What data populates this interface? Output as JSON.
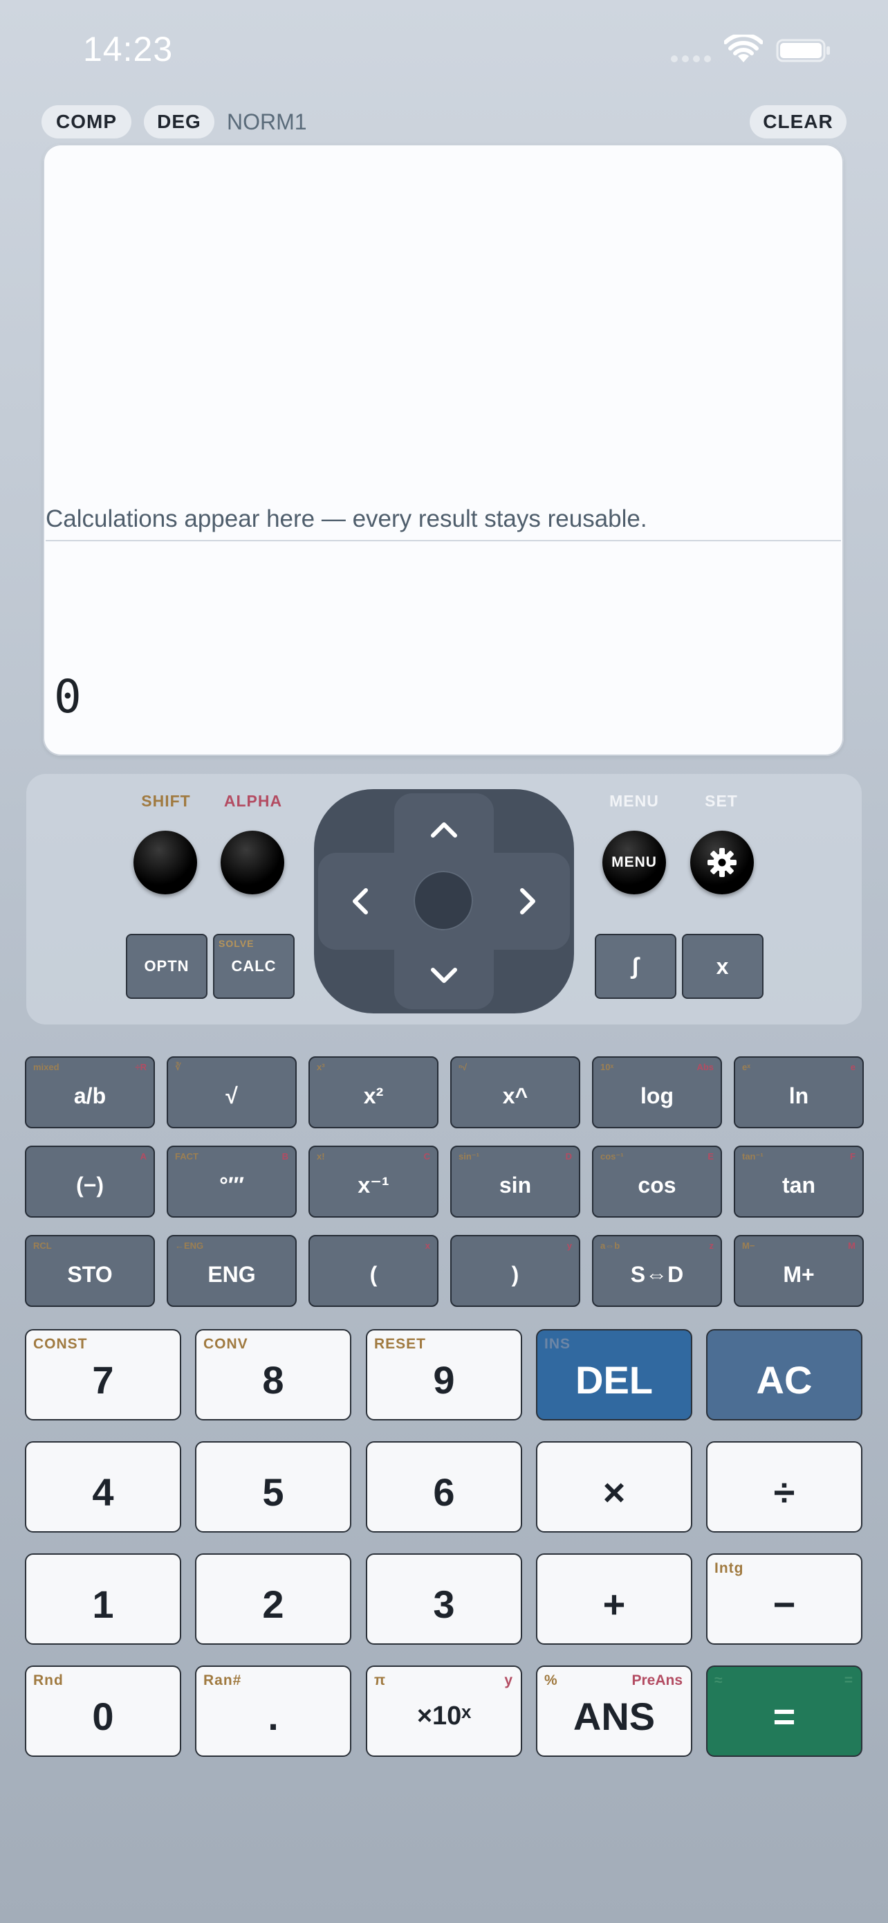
{
  "status_bar": {
    "time": "14:23"
  },
  "mode_bar": {
    "comp": "COMP",
    "deg": "DEG",
    "norm": "NORM1",
    "clear": "CLEAR"
  },
  "display": {
    "hint": "Calculations appear here — every result stays reusable.",
    "result": "0"
  },
  "controls": {
    "shift_label": "SHIFT",
    "alpha_label": "ALPHA",
    "menu_label": "MENU",
    "menu_button": "MENU",
    "set_label": "SET",
    "optn": "OPTN",
    "calc": "CALC",
    "calc_shift": "SOLVE",
    "integral": "∫",
    "x_key": "x"
  },
  "function_keys": [
    {
      "name": "fraction-key",
      "label": "a/b",
      "shift": "mixed",
      "alpha": "÷R"
    },
    {
      "name": "sqrt-key",
      "label": "√",
      "shift": "∛",
      "alpha": ""
    },
    {
      "name": "square-key",
      "label": "x²",
      "shift": "x³",
      "alpha": ""
    },
    {
      "name": "power-key",
      "label": "x^",
      "shift": "ⁿ√",
      "alpha": ""
    },
    {
      "name": "log-key",
      "label": "log",
      "shift": "10ˣ",
      "alpha": "Abs"
    },
    {
      "name": "ln-key",
      "label": "ln",
      "shift": "eˣ",
      "alpha": "e"
    },
    {
      "name": "negative-key",
      "label": "(−)",
      "shift": "",
      "alpha": "A"
    },
    {
      "name": "dms-key",
      "label": "°′″",
      "shift": "FACT",
      "alpha": "B"
    },
    {
      "name": "reciprocal-key",
      "label": "x⁻¹",
      "shift": "x!",
      "alpha": "C"
    },
    {
      "name": "sin-key",
      "label": "sin",
      "shift": "sin⁻¹",
      "alpha": "D"
    },
    {
      "name": "cos-key",
      "label": "cos",
      "shift": "cos⁻¹",
      "alpha": "E"
    },
    {
      "name": "tan-key",
      "label": "tan",
      "shift": "tan⁻¹",
      "alpha": "F"
    },
    {
      "name": "sto-key",
      "label": "STO",
      "shift": "RCL",
      "alpha": ""
    },
    {
      "name": "eng-key",
      "label": "ENG",
      "shift": "←ENG",
      "alpha": ""
    },
    {
      "name": "open-paren-key",
      "label": "(",
      "shift": "",
      "alpha": "x"
    },
    {
      "name": "close-paren-key",
      "label": ")",
      "shift": "",
      "alpha": "y"
    },
    {
      "name": "s-d-key",
      "label": "S⇔D",
      "shift": "a⇔b",
      "alpha": "z"
    },
    {
      "name": "m-plus-key",
      "label": "M+",
      "shift": "M−",
      "alpha": "M"
    }
  ],
  "number_keys": [
    {
      "name": "key-7",
      "label": "7",
      "shift": "CONST",
      "alpha": ""
    },
    {
      "name": "key-8",
      "label": "8",
      "shift": "CONV",
      "alpha": ""
    },
    {
      "name": "key-9",
      "label": "9",
      "shift": "RESET",
      "alpha": ""
    },
    {
      "name": "del-key",
      "label": "DEL",
      "shift": "INS",
      "alpha": ""
    },
    {
      "name": "ac-key",
      "label": "AC",
      "shift": "",
      "alpha": ""
    },
    {
      "name": "key-4",
      "label": "4",
      "shift": "",
      "alpha": ""
    },
    {
      "name": "key-5",
      "label": "5",
      "shift": "",
      "alpha": ""
    },
    {
      "name": "key-6",
      "label": "6",
      "shift": "",
      "alpha": ""
    },
    {
      "name": "multiply-key",
      "label": "×",
      "shift": "",
      "alpha": ""
    },
    {
      "name": "divide-key",
      "label": "÷",
      "shift": "",
      "alpha": ""
    },
    {
      "name": "key-1",
      "label": "1",
      "shift": "",
      "alpha": ""
    },
    {
      "name": "key-2",
      "label": "2",
      "shift": "",
      "alpha": ""
    },
    {
      "name": "key-3",
      "label": "3",
      "shift": "",
      "alpha": ""
    },
    {
      "name": "plus-key",
      "label": "+",
      "shift": "",
      "alpha": ""
    },
    {
      "name": "minus-key",
      "label": "−",
      "shift": "Intg",
      "alpha": ""
    },
    {
      "name": "key-0",
      "label": "0",
      "shift": "Rnd",
      "alpha": ""
    },
    {
      "name": "decimal-key",
      "label": ".",
      "shift": "Ran#",
      "alpha": ""
    },
    {
      "name": "exp-key",
      "label": "×10ˣ",
      "shift": "π",
      "alpha": "y"
    },
    {
      "name": "ans-key",
      "label": "ANS",
      "shift": "%",
      "alpha": "PreAns"
    },
    {
      "name": "equals-key",
      "label": "=",
      "shift": "≈",
      "alpha": "="
    }
  ]
}
